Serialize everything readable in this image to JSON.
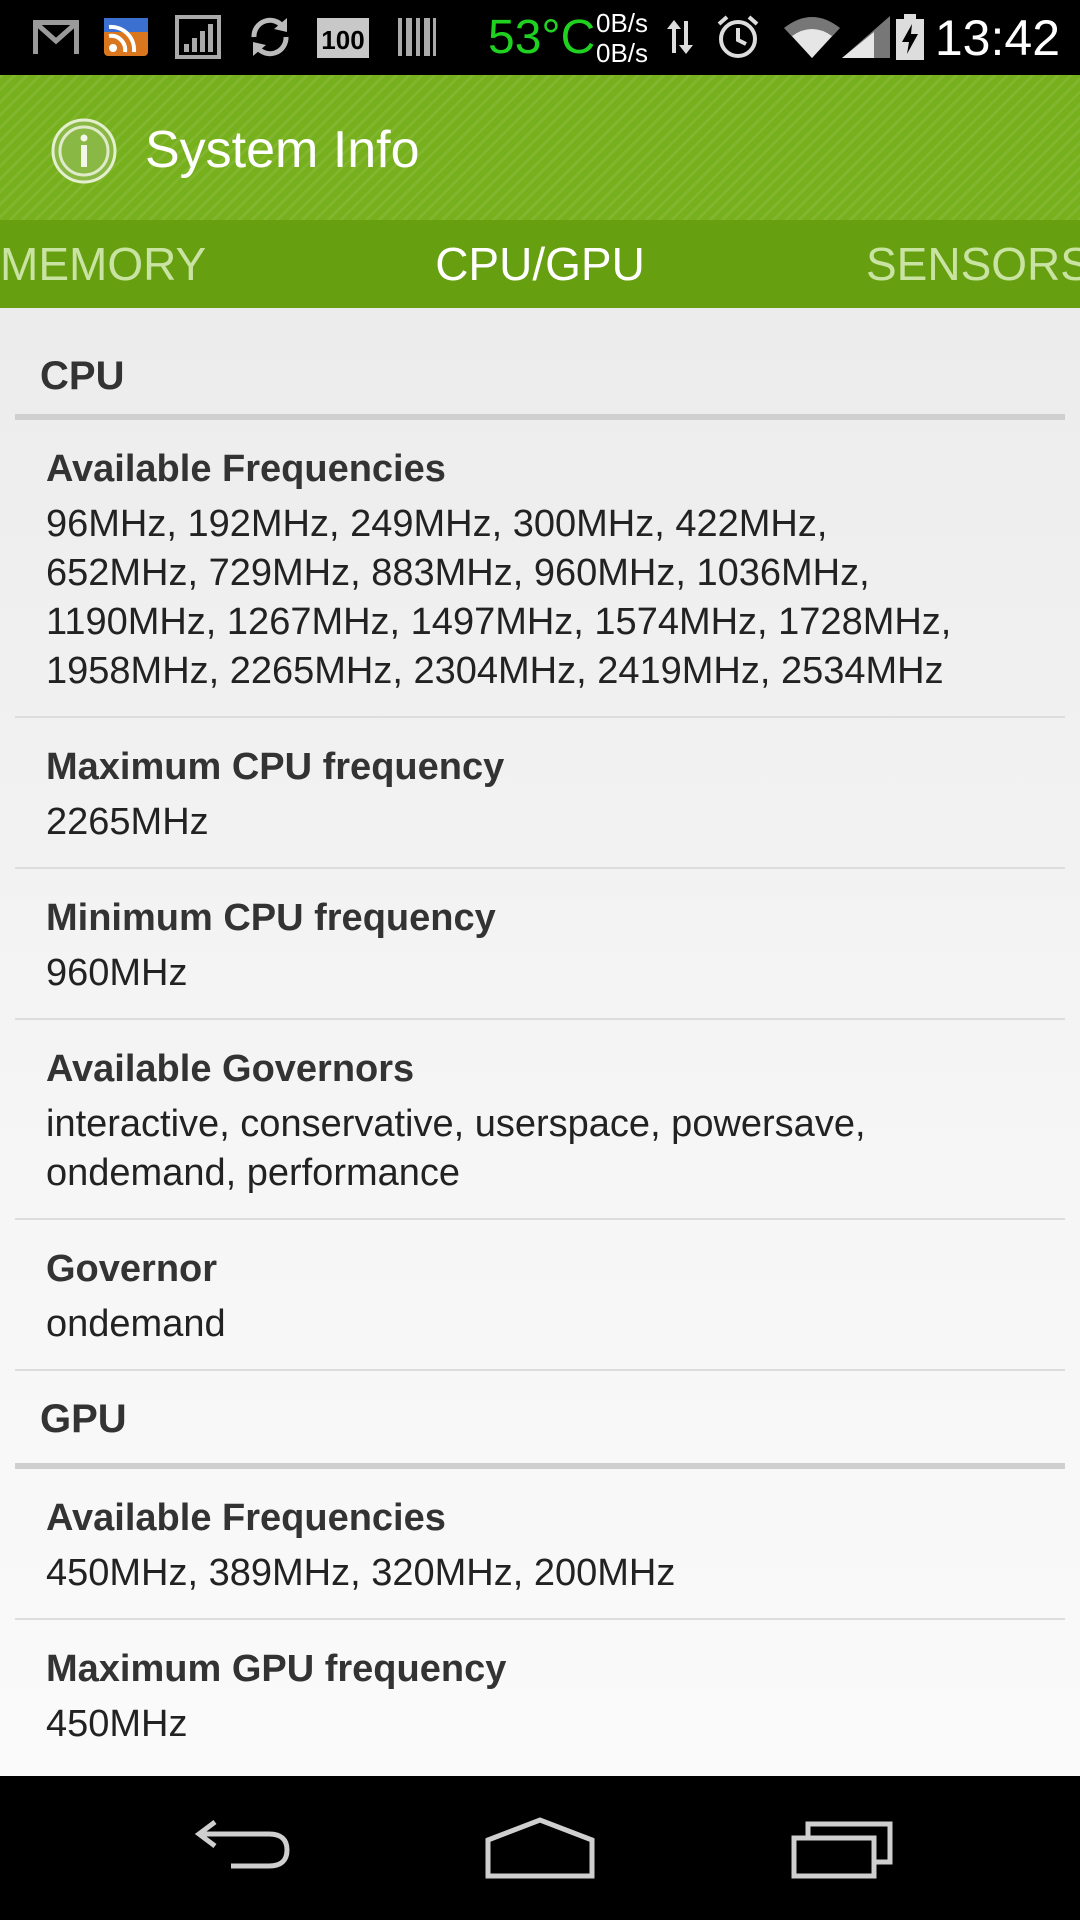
{
  "status_bar": {
    "icons": [
      "gmail-icon",
      "rss-icon",
      "signal-meter-icon",
      "sync-icon",
      "battery-100-icon",
      "barcode-icon",
      "transfer-arrows-icon",
      "alarm-icon",
      "wifi-icon",
      "cell-signal-icon",
      "battery-charging-icon"
    ],
    "temperature": "53°C",
    "net_up": "0B/s",
    "net_down": "0B/s",
    "battery_badge": "100",
    "time": "13:42",
    "temperature_color": "#1fd21f"
  },
  "app": {
    "title": "System Info",
    "icon": "info-icon",
    "accent_color": "#76b01c",
    "tab_bar_color": "#669f10"
  },
  "tabs": {
    "left": "MEMORY",
    "active": "CPU/GPU",
    "right": "SENSORS"
  },
  "sections": {
    "cpu": {
      "title": "CPU",
      "items": [
        {
          "label": "Available Frequencies",
          "lines": [
            "96MHz, 192MHz, 249MHz, 300MHz, 422MHz,",
            "652MHz, 729MHz, 883MHz, 960MHz, 1036MHz,",
            "1190MHz, 1267MHz, 1497MHz, 1574MHz, 1728MHz,",
            "1958MHz, 2265MHz, 2304MHz, 2419MHz, 2534MHz"
          ]
        },
        {
          "label": "Maximum CPU frequency",
          "lines": [
            "2265MHz"
          ]
        },
        {
          "label": "Minimum CPU frequency",
          "lines": [
            "960MHz"
          ]
        },
        {
          "label": "Available Governors",
          "lines": [
            "interactive, conservative, userspace, powersave,",
            "ondemand, performance"
          ]
        },
        {
          "label": "Governor",
          "lines": [
            "ondemand"
          ]
        }
      ]
    },
    "gpu": {
      "title": "GPU",
      "items": [
        {
          "label": "Available Frequencies",
          "lines": [
            "450MHz, 389MHz, 320MHz, 200MHz"
          ]
        },
        {
          "label": "Maximum GPU frequency",
          "lines": [
            "450MHz"
          ]
        }
      ]
    }
  },
  "nav_bar": {
    "icons": [
      "back-icon",
      "home-icon",
      "recent-apps-icon"
    ]
  }
}
